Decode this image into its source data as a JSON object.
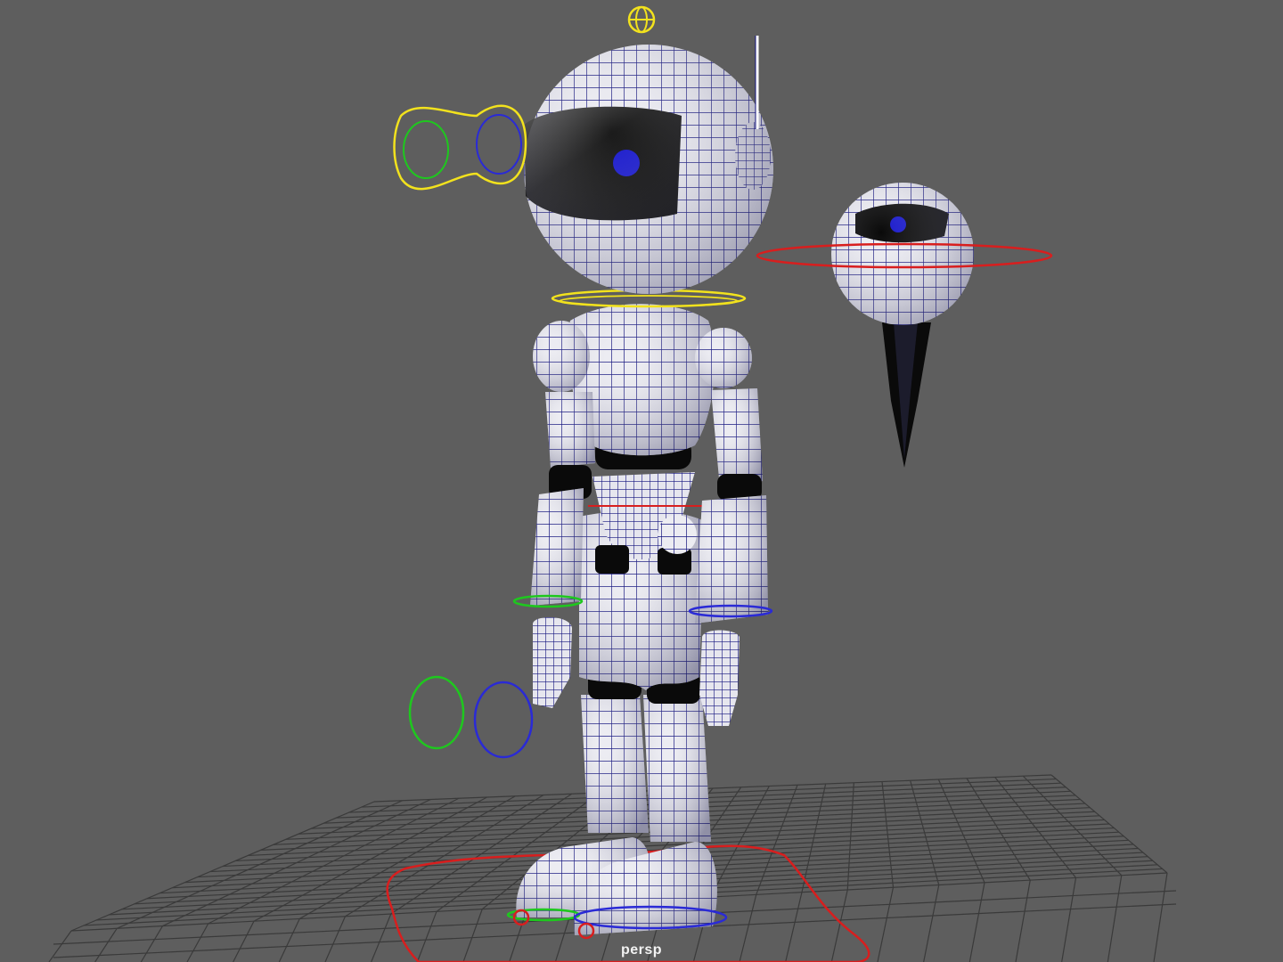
{
  "viewport": {
    "camera_name": "persp",
    "background_color": "#5e5e5e",
    "grid_color": "#3a3a3a",
    "wire_color": "#0d0d8a",
    "surface_color": "#e9e9ef",
    "visor_color": "#111111"
  },
  "controls": {
    "yellow": "#f2e21d",
    "red": "#d81e1e",
    "green": "#1ec81e",
    "blue": "#2a2ad6"
  }
}
